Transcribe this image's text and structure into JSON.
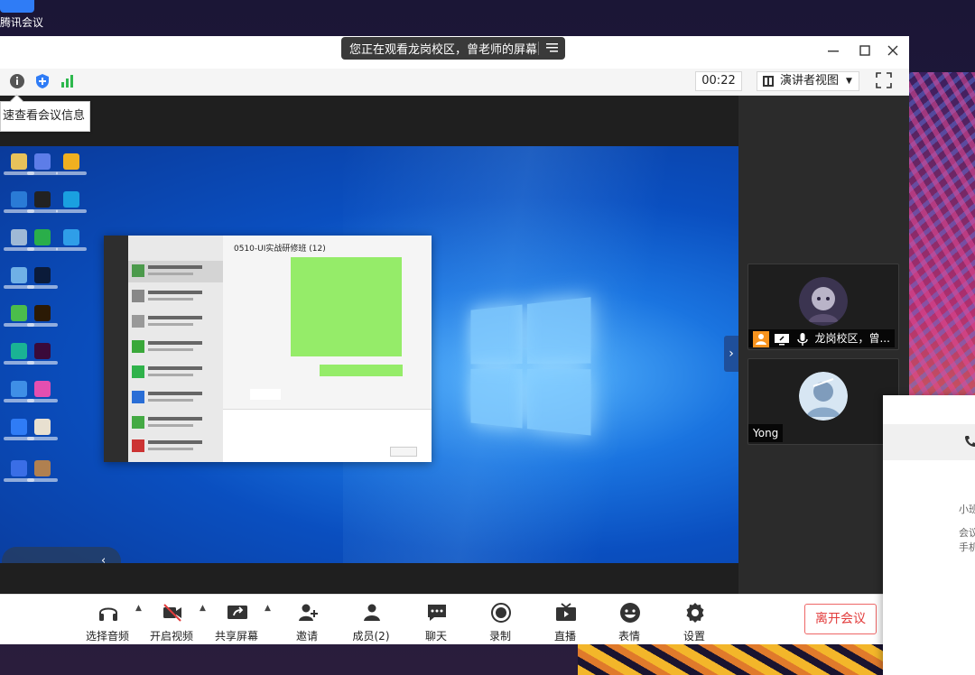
{
  "desktop": {
    "app_label": "腾讯会议"
  },
  "titlebar": {
    "banner_text": "您正在观看龙岗校区，曾老师的屏幕"
  },
  "toolbar": {
    "timer": "00:22",
    "view_label": "演讲者视图"
  },
  "tooltip": {
    "text": "速查看会议信息"
  },
  "shared_screen": {
    "chat_title": "0510-UI实战研修班 (12)"
  },
  "participants": [
    {
      "name": "龙岗校区，曾...",
      "avatar_color": "#4a4a6a"
    },
    {
      "name": "Yong",
      "avatar_color": "#a9c6e8"
    }
  ],
  "controls": [
    {
      "label": "选择音频",
      "icon": "headset-icon"
    },
    {
      "label": "开启视频",
      "icon": "camera-off-icon"
    },
    {
      "label": "共享屏幕",
      "icon": "share-screen-icon"
    },
    {
      "label": "邀请",
      "icon": "invite-icon"
    },
    {
      "label": "成员(2)",
      "icon": "members-icon"
    },
    {
      "label": "聊天",
      "icon": "chat-icon"
    },
    {
      "label": "录制",
      "icon": "record-icon"
    },
    {
      "label": "直播",
      "icon": "live-icon"
    },
    {
      "label": "表情",
      "icon": "emoji-icon"
    },
    {
      "label": "设置",
      "icon": "settings-icon"
    }
  ],
  "leave_label": "离开会议",
  "popup": {
    "line1": "小⁠班",
    "line2": "会议",
    "line3": "手机"
  },
  "colors": {
    "accent_blue": "#1f4f9a",
    "leave_red": "#e23b3b",
    "security_blue": "#2f7cf6",
    "signal_green": "#2db84d",
    "speaker_orange": "#f7931e"
  }
}
